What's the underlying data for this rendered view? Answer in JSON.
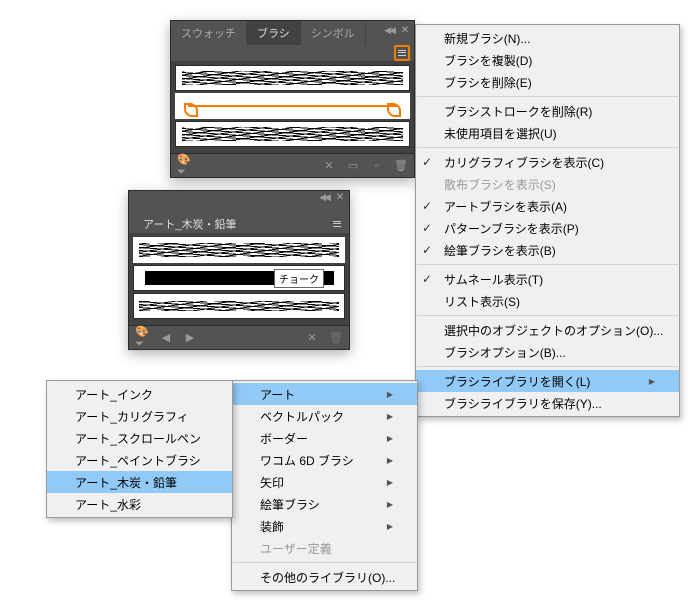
{
  "panel1": {
    "tabs": [
      "スウォッチ",
      "ブラシ",
      "シンボル"
    ],
    "activeTab": 1
  },
  "panel2": {
    "title": "アート_木炭・鉛筆",
    "tooltip": "チョーク"
  },
  "mainMenu": {
    "items": [
      {
        "label": "新規ブラシ(N)..."
      },
      {
        "label": "ブラシを複製(D)"
      },
      {
        "label": "ブラシを削除(E)"
      }
    ],
    "items2": [
      {
        "label": "ブラシストロークを削除(R)"
      },
      {
        "label": "未使用項目を選択(U)"
      }
    ],
    "items3": [
      {
        "label": "カリグラフィブラシを表示(C)",
        "checked": true
      },
      {
        "label": "散布ブラシを表示(S)",
        "disabled": true
      },
      {
        "label": "アートブラシを表示(A)",
        "checked": true
      },
      {
        "label": "パターンブラシを表示(P)",
        "checked": true
      },
      {
        "label": "絵筆ブラシを表示(B)",
        "checked": true
      }
    ],
    "items4": [
      {
        "label": "サムネール表示(T)",
        "checked": true
      },
      {
        "label": "リスト表示(S)"
      }
    ],
    "items5": [
      {
        "label": "選択中のオブジェクトのオプション(O)..."
      },
      {
        "label": "ブラシオプション(B)..."
      }
    ],
    "items6": [
      {
        "label": "ブラシライブラリを開く(L)",
        "arrow": true,
        "highlight": true
      },
      {
        "label": "ブラシライブラリを保存(Y)..."
      }
    ]
  },
  "subMenu1": {
    "items": [
      {
        "label": "アート",
        "arrow": true,
        "highlight": true
      },
      {
        "label": "ベクトルパック",
        "arrow": true
      },
      {
        "label": "ボーダー",
        "arrow": true
      },
      {
        "label": "ワコム 6D ブラシ",
        "arrow": true
      },
      {
        "label": "矢印",
        "arrow": true
      },
      {
        "label": "絵筆ブラシ",
        "arrow": true
      },
      {
        "label": "装飾",
        "arrow": true
      },
      {
        "label": "ユーザー定義",
        "disabled": true
      }
    ],
    "last": "その他のライブラリ(O)..."
  },
  "subMenu2": {
    "items": [
      "アート_インク",
      "アート_カリグラフィ",
      "アート_スクロールペン",
      "アート_ペイントブラシ",
      "アート_木炭・鉛筆",
      "アート_水彩"
    ],
    "highlightIndex": 4
  }
}
